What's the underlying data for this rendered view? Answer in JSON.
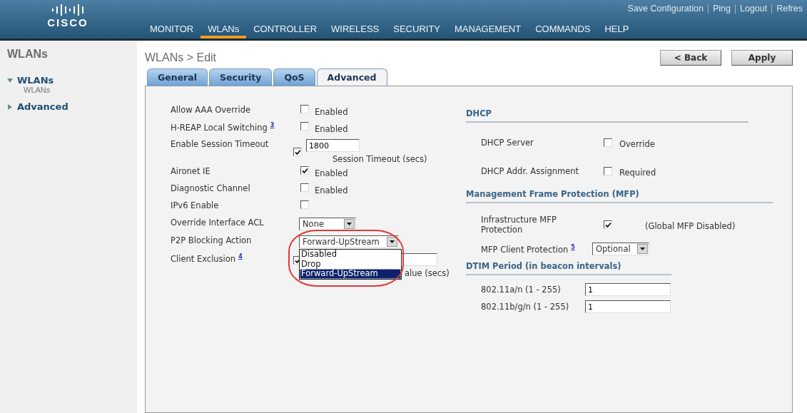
{
  "header": {
    "logo_text": "CISCO",
    "top_links": [
      "Save Configuration",
      "Ping",
      "Logout",
      "Refres"
    ],
    "nav": [
      {
        "label": "MONITOR",
        "selected": false
      },
      {
        "label": "WLANs",
        "selected": true
      },
      {
        "label": "CONTROLLER",
        "selected": false
      },
      {
        "label": "WIRELESS",
        "selected": false
      },
      {
        "label": "SECURITY",
        "selected": false
      },
      {
        "label": "MANAGEMENT",
        "selected": false
      },
      {
        "label": "COMMANDS",
        "selected": false
      },
      {
        "label": "HELP",
        "selected": false
      }
    ]
  },
  "sidebar": {
    "title": "WLANs",
    "items": [
      {
        "label": "WLANs",
        "expanded": true,
        "children": [
          {
            "label": "WLANs"
          }
        ]
      },
      {
        "label": "Advanced",
        "expanded": false
      }
    ]
  },
  "page": {
    "title": "WLANs > Edit",
    "buttons": [
      "< Back",
      "Apply"
    ],
    "tabs": [
      {
        "label": "General",
        "selected": false
      },
      {
        "label": "Security",
        "selected": false
      },
      {
        "label": "QoS",
        "selected": false
      },
      {
        "label": "Advanced",
        "selected": true
      }
    ]
  },
  "left_rows": [
    {
      "kind": "checkbox",
      "label": "Allow AAA Override",
      "checked": false,
      "option": "Enabled"
    },
    {
      "kind": "checkbox",
      "label": "H-REAP Local Switching",
      "footnote": "3",
      "checked": false,
      "option": "Enabled"
    },
    {
      "kind": "timeout",
      "label": "Enable Session Timeout",
      "checked": true,
      "value": "1800",
      "caption": "Session Timeout (secs)"
    },
    {
      "kind": "checkbox",
      "label": "Aironet IE",
      "checked": true,
      "option": "Enabled"
    },
    {
      "kind": "checkbox",
      "label": "Diagnostic Channel",
      "checked": false,
      "option": "Enabled"
    },
    {
      "kind": "checkbox",
      "label": "IPv6 Enable",
      "checked": false
    },
    {
      "kind": "select",
      "label": "Override Interface ACL",
      "value": "None"
    },
    {
      "kind": "dropdown_open",
      "label": "P2P Blocking Action",
      "value": "Forward-UpStream",
      "options": [
        {
          "label": "Disabled",
          "selected": false
        },
        {
          "label": "Drop",
          "selected": false
        },
        {
          "label": "Forward-UpStream",
          "selected": true
        }
      ]
    },
    {
      "kind": "exclusion",
      "label": "Client Exclusion",
      "footnote": "4",
      "checked": true,
      "caption": "alue (secs)"
    }
  ],
  "right_sections": [
    {
      "title": "DHCP",
      "rows": [
        {
          "kind": "checkbox",
          "label": "DHCP Server",
          "checked": false,
          "option": "Override"
        },
        {
          "kind": "checkbox",
          "label": "DHCP Addr. Assignment",
          "checked": false,
          "option": "Required"
        }
      ]
    },
    {
      "title": "Management Frame Protection (MFP)",
      "rows": [
        {
          "kind": "checkbox",
          "label": "Infrastructure MFP Protection",
          "checked": true,
          "option": "(Global MFP Disabled)"
        },
        {
          "kind": "select",
          "label": "MFP Client Protection",
          "footnote": "5",
          "value": "Optional"
        }
      ]
    },
    {
      "title": "DTIM Period (in beacon intervals)",
      "rows": [
        {
          "kind": "input",
          "label": "802.11a/n (1 - 255)",
          "value": "1"
        },
        {
          "kind": "input",
          "label": "802.11b/g/n (1 - 255)",
          "value": "1"
        }
      ]
    }
  ]
}
